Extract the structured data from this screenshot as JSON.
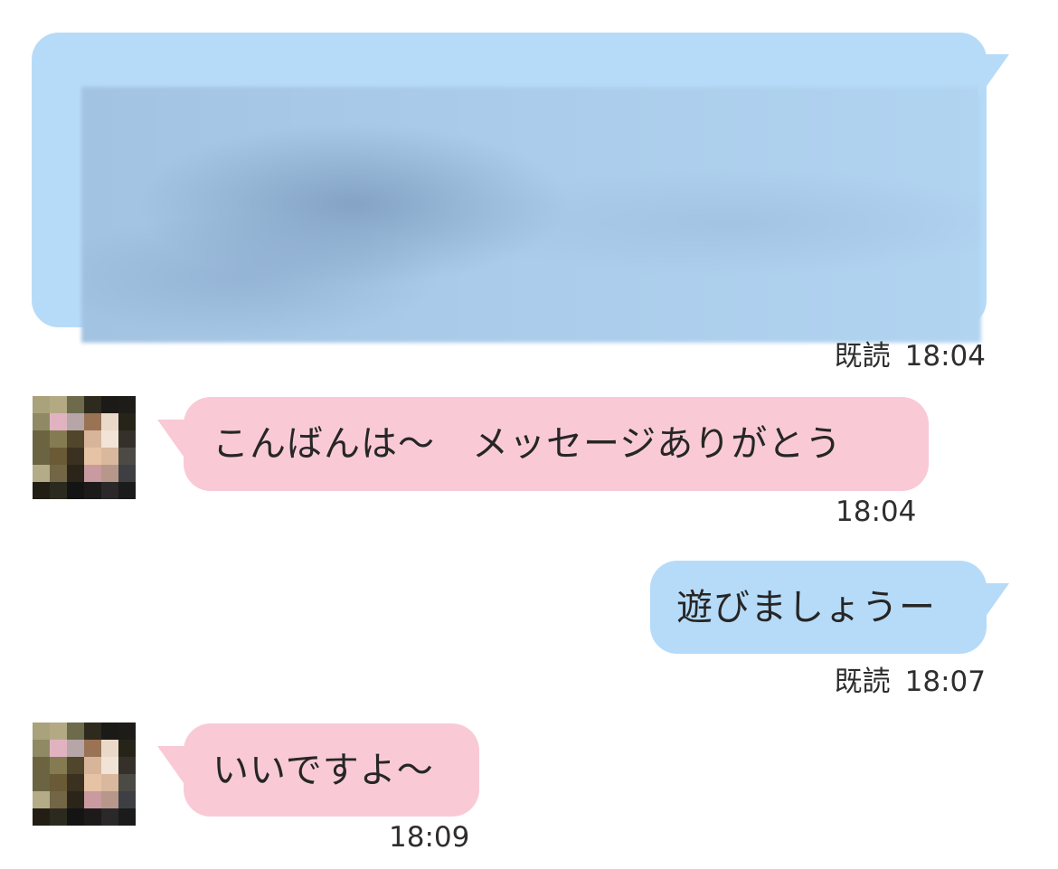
{
  "chat": {
    "messages": [
      {
        "side": "out",
        "text": "",
        "redacted": true,
        "read_label": "既読",
        "time": "18:04"
      },
      {
        "side": "in",
        "text": "こんばんは〜　メッセージありがとう",
        "time": "18:04",
        "avatar_icon": "pixelated-avatar-icon"
      },
      {
        "side": "out",
        "text": "遊びましょうー",
        "read_label": "既読",
        "time": "18:07"
      },
      {
        "side": "in",
        "text": "いいですよ〜",
        "time": "18:09",
        "avatar_icon": "pixelated-avatar-icon"
      }
    ],
    "colors": {
      "outgoing_bubble": "#b6dbf8",
      "incoming_bubble": "#f9cad6",
      "background": "#ffffff"
    }
  }
}
